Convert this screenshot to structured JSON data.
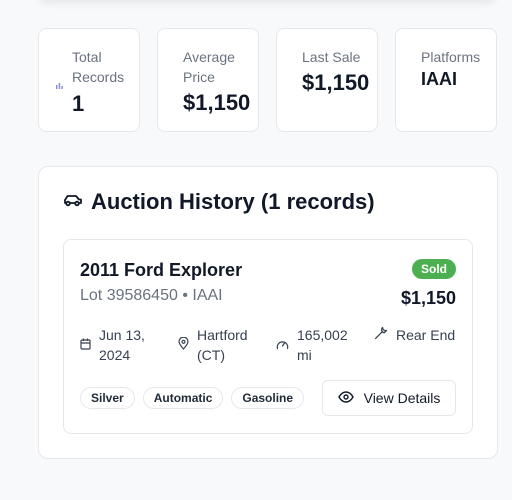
{
  "stats": [
    {
      "label": "Total Records",
      "value": "1",
      "icon": "chart-icon"
    },
    {
      "label": "Average Price",
      "value": "$1,150"
    },
    {
      "label": "Last Sale",
      "value": "$1,150"
    },
    {
      "label": "Platforms",
      "value": "IAAI"
    }
  ],
  "history": {
    "title": "Auction History (1 records)",
    "icon": "car-icon",
    "record": {
      "title": "2011 Ford Explorer",
      "lot": "Lot 39586450 • IAAI",
      "status": "Sold",
      "status_color": "#4caf50",
      "price": "$1,150",
      "date": "Jun 13, 2024",
      "location": "Hartford (CT)",
      "mileage": "165,002 mi",
      "damage": "Rear End",
      "tags": [
        "Silver",
        "Automatic",
        "Gasoline"
      ],
      "view_label": "View Details"
    }
  }
}
